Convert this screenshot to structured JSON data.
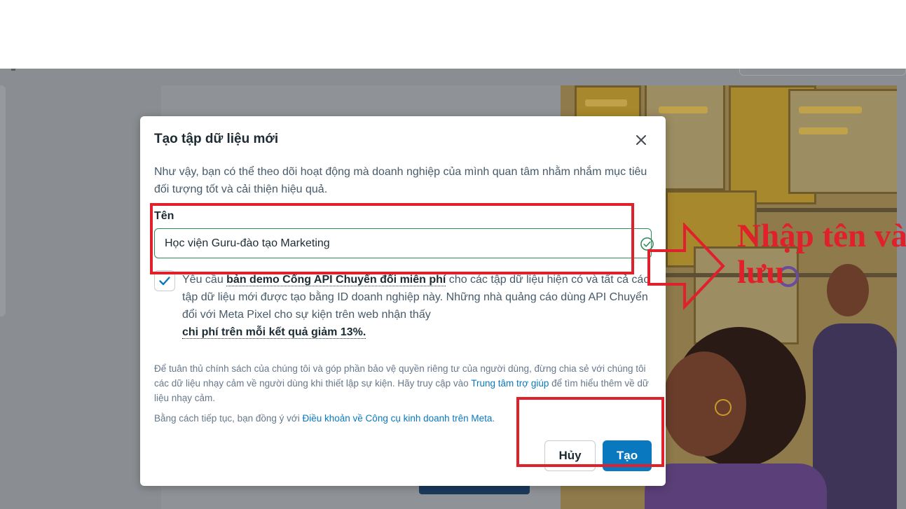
{
  "modal": {
    "title": "Tạo tập dữ liệu mới",
    "intro": "Như vậy, bạn có thể theo dõi hoạt động mà doanh nghiệp của mình quan tâm nhằm nhắm mục tiêu đối tượng tốt và cải thiện hiệu quả.",
    "name_label": "Tên",
    "name_value": "Học viện Guru-đào tạo Marketing",
    "consent": {
      "checked": true,
      "part1": "Yêu cầu ",
      "bold_link": "bản demo Cổng API Chuyển đổi miễn phí",
      "part2": " cho các tập dữ liệu hiện có và tất cả các tập dữ liệu mới được tạo bằng ID doanh nghiệp này. Những nhà quảng cáo dùng API Chuyển đổi với Meta Pixel cho sự kiện trên web nhận thấy ",
      "bold_stat": "chi phí trên mỗi kết quả giảm 13%."
    },
    "privacy": {
      "part1": "Để tuân thủ chính sách của chúng tôi và góp phần bảo vệ quyền riêng tư của người dùng, đừng chia sẻ với chúng tôi các dữ liệu nhạy cảm về người dùng khi thiết lập sự kiện. Hãy truy cập vào ",
      "link": "Trung tâm trợ giúp",
      "part2": " để tìm hiểu thêm về dữ liệu nhạy cảm."
    },
    "terms": {
      "part1": "Bằng cách tiếp tục, bạn đồng ý với ",
      "link": "Điều khoản về Công cụ kinh doanh trên Meta",
      "part2": "."
    },
    "cancel_label": "Hủy",
    "create_label": "Tạo"
  },
  "annotation": {
    "line1": "Nhập tên và",
    "line2": "lưu"
  },
  "colors": {
    "primary": "#0a78be",
    "annotation_red": "#e0202a",
    "valid_green": "#2e8a57"
  },
  "icons": [
    "close-icon",
    "checkmark-icon",
    "valid-check-icon",
    "arrow-right-icon"
  ]
}
